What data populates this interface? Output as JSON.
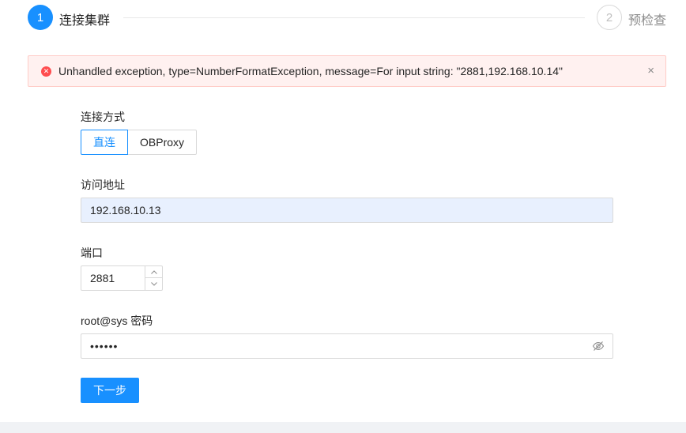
{
  "steps": [
    {
      "number": "1",
      "title": "连接集群"
    },
    {
      "number": "2",
      "title": "预检查"
    }
  ],
  "alert": {
    "message": "Unhandled exception, type=NumberFormatException, message=For input string: \"2881,192.168.10.14\"",
    "close_glyph": "×"
  },
  "form": {
    "connection_mode": {
      "label": "连接方式",
      "options": [
        "直连",
        "OBProxy"
      ],
      "selected": "直连"
    },
    "address": {
      "label": "访问地址",
      "value": "192.168.10.13"
    },
    "port": {
      "label": "端口",
      "value": "2881"
    },
    "password": {
      "label": "root@sys 密码",
      "value": "••••••"
    },
    "next_label": "下一步"
  },
  "colors": {
    "primary": "#1890ff",
    "error": "#ff4d4f",
    "alert_bg": "#fff1f0",
    "autofill_bg": "#e8f0fe"
  }
}
